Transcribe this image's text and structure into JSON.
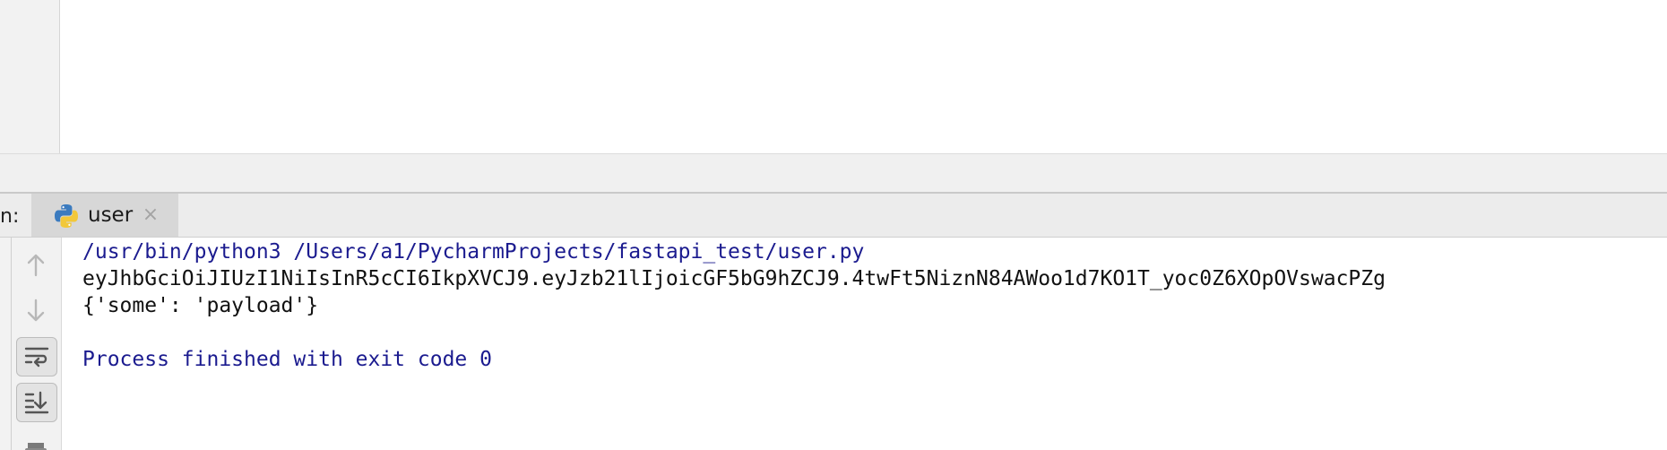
{
  "run_panel": {
    "label": "n:",
    "tab": {
      "title": "user",
      "close_glyph": "×",
      "icon": "python-icon"
    }
  },
  "toolbar": {
    "buttons": [
      {
        "name": "up-arrow-icon"
      },
      {
        "name": "down-arrow-icon"
      },
      {
        "name": "soft-wrap-icon"
      },
      {
        "name": "scroll-to-end-icon"
      },
      {
        "name": "print-icon"
      }
    ]
  },
  "console": {
    "lines": [
      "/usr/bin/python3 /Users/a1/PycharmProjects/fastapi_test/user.py",
      "eyJhbGciOiJIUzI1NiIsInR5cCI6IkpXVCJ9.eyJzb21lIjoicGF5bG9hZCJ9.4twFt5NiznN84AWoo1d7KO1T_yoc0Z6XOpOVswacPZg",
      "{'some': 'payload'}",
      "",
      "Process finished with exit code 0"
    ]
  },
  "colors": {
    "command": "#1b1b8f",
    "output": "#111111"
  }
}
